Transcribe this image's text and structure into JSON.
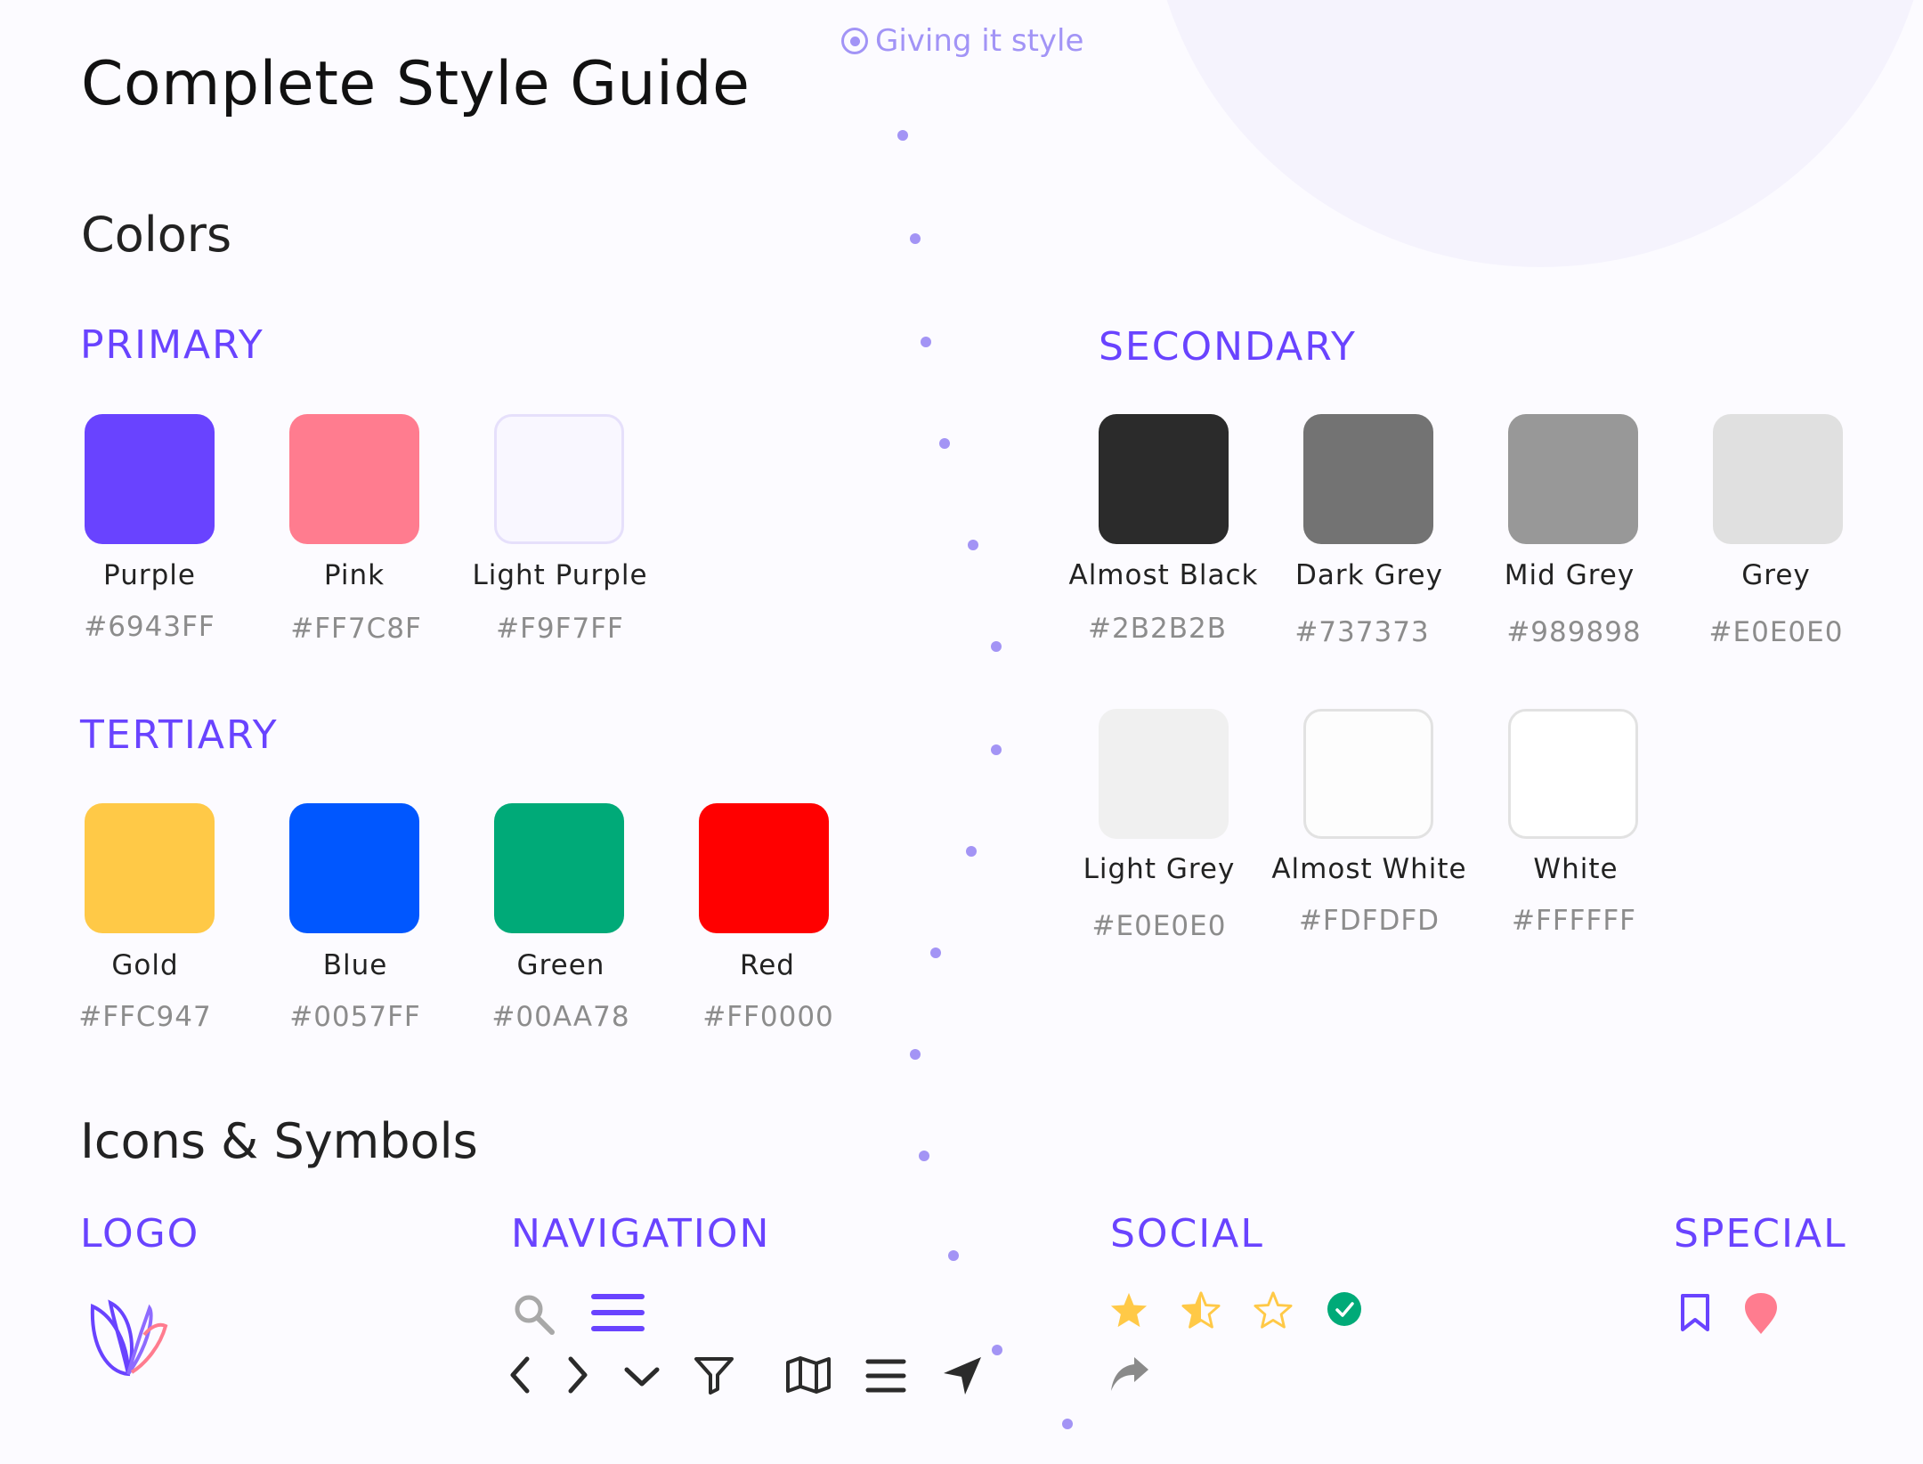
{
  "header": {
    "title": "Complete Style Guide",
    "badge": "Giving it style"
  },
  "colors_section": {
    "heading": "Colors"
  },
  "primary": {
    "heading": "PRIMARY",
    "swatches": [
      {
        "name": "Purple",
        "hex": "#6943FF"
      },
      {
        "name": "Pink",
        "hex": "#FF7C8F"
      },
      {
        "name": "Light Purple",
        "hex": "#F9F7FF"
      }
    ]
  },
  "tertiary": {
    "heading": "TERTIARY",
    "swatches": [
      {
        "name": "Gold",
        "hex": "#FFC947"
      },
      {
        "name": "Blue",
        "hex": "#0057FF"
      },
      {
        "name": "Green",
        "hex": "#00AA78"
      },
      {
        "name": "Red",
        "hex": "#FF0000"
      }
    ]
  },
  "secondary": {
    "heading": "SECONDARY",
    "swatches": [
      {
        "name": "Almost Black",
        "hex": "#2B2B2B"
      },
      {
        "name": "Dark Grey",
        "hex": "#737373"
      },
      {
        "name": "Mid Grey",
        "hex": "#989898"
      },
      {
        "name": "Grey",
        "hex": "#E0E0E0"
      },
      {
        "name": "Light Grey",
        "hex": "#E0E0E0"
      },
      {
        "name": "Almost White",
        "hex": "#FDFDFD"
      },
      {
        "name": "White",
        "hex": "#FFFFFF"
      }
    ]
  },
  "icons_section": {
    "heading": "Icons & Symbols",
    "logo": {
      "heading": "LOGO",
      "icon": "butterfly-logo"
    },
    "navigation": {
      "heading": "NAVIGATION",
      "icons": [
        "search-icon",
        "menu-icon",
        "chevron-left-icon",
        "chevron-right-icon",
        "chevron-down-icon",
        "filter-icon",
        "map-icon",
        "list-icon",
        "navigate-arrow-icon"
      ]
    },
    "social": {
      "heading": "SOCIAL",
      "icons": [
        "star-filled-icon",
        "star-half-icon",
        "star-outline-icon",
        "check-circle-icon",
        "share-icon"
      ]
    },
    "special": {
      "heading": "SPECIAL",
      "icons": [
        "bookmark-icon",
        "location-pin-icon"
      ]
    }
  },
  "palette": {
    "accent": "#6943FF",
    "dots": "#A394F5",
    "star": "#FFC947",
    "check": "#00AA78",
    "pin": "#FF7C8F"
  }
}
